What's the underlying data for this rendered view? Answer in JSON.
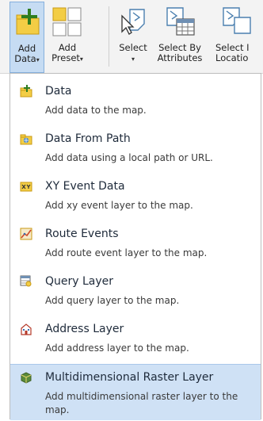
{
  "ribbon": {
    "add_data": {
      "line1": "Add",
      "line2": "Data"
    },
    "add_preset": {
      "line1": "Add",
      "line2": "Preset"
    },
    "select": {
      "line1": "Select"
    },
    "select_by_attributes": {
      "line1": "Select By",
      "line2": "Attributes"
    },
    "select_by_location": {
      "line1": "Select I",
      "line2": "Locatio"
    },
    "dropdown_arrow": "▾"
  },
  "menu": {
    "items": [
      {
        "title": "Data",
        "desc": "Add data to the map.",
        "icon": "add-data-icon"
      },
      {
        "title": "Data From Path",
        "desc": "Add data using a local path or URL.",
        "icon": "data-from-path-icon"
      },
      {
        "title": "XY Event Data",
        "desc": "Add xy event layer to the map.",
        "icon": "xy-event-icon"
      },
      {
        "title": "Route Events",
        "desc": "Add route event layer to the map.",
        "icon": "route-events-icon"
      },
      {
        "title": "Query Layer",
        "desc": "Add query layer to the map.",
        "icon": "query-layer-icon"
      },
      {
        "title": "Address Layer",
        "desc": "Add address layer to the map.",
        "icon": "address-layer-icon"
      },
      {
        "title": "Multidimensional Raster Layer",
        "desc": "Add multidimensional raster layer to the map.",
        "icon": "multidimensional-raster-icon"
      }
    ]
  },
  "colors": {
    "selected_bg": "#cfe1f5",
    "ribbon_bg": "#f3f3f3",
    "icon_yellow": "#e8b92a"
  }
}
